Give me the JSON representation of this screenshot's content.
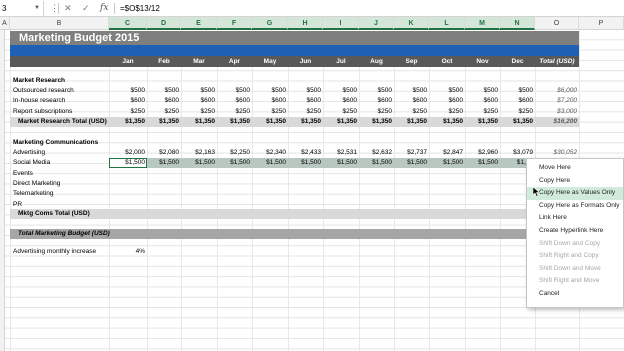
{
  "formula_bar": {
    "name_box": "3",
    "formula": "=$O$13/12",
    "cancel_symbol": "✕",
    "enter_symbol": "✓",
    "fx_symbol": "fx"
  },
  "columns": [
    "A",
    "B",
    "C",
    "D",
    "E",
    "F",
    "G",
    "H",
    "I",
    "J",
    "K",
    "L",
    "M",
    "N",
    "O",
    "P"
  ],
  "sheet": {
    "title": "Marketing Budget 2015",
    "months": [
      "Jan",
      "Feb",
      "Mar",
      "Apr",
      "May",
      "Jun",
      "Jul",
      "Aug",
      "Sep",
      "Oct",
      "Nov",
      "Dec"
    ],
    "total_header": "Total (USD)",
    "market_research": {
      "heading": "Market Research",
      "rows": [
        {
          "label": "Outsourced research",
          "values": [
            "$500",
            "$500",
            "$500",
            "$500",
            "$500",
            "$500",
            "$500",
            "$500",
            "$500",
            "$500",
            "$500",
            "$500"
          ],
          "total": "$6,000"
        },
        {
          "label": "In-house research",
          "values": [
            "$600",
            "$600",
            "$600",
            "$600",
            "$600",
            "$600",
            "$600",
            "$600",
            "$600",
            "$600",
            "$600",
            "$600"
          ],
          "total": "$7,200"
        },
        {
          "label": "Report subscriptions",
          "values": [
            "$250",
            "$250",
            "$250",
            "$250",
            "$250",
            "$250",
            "$250",
            "$250",
            "$250",
            "$250",
            "$250",
            "$250"
          ],
          "total": "$3,000"
        }
      ],
      "total_row": {
        "label": "Market Research Total (USD)",
        "values": [
          "$1,350",
          "$1,350",
          "$1,350",
          "$1,350",
          "$1,350",
          "$1,350",
          "$1,350",
          "$1,350",
          "$1,350",
          "$1,350",
          "$1,350",
          "$1,350"
        ],
        "total": "$16,200"
      }
    },
    "marketing_comms": {
      "heading": "Marketing Communications",
      "rows": [
        {
          "label": "Advertising",
          "values": [
            "$2,000",
            "$2,080",
            "$2,163",
            "$2,250",
            "$2,340",
            "$2,433",
            "$2,531",
            "$2,632",
            "$2,737",
            "$2,847",
            "$2,960",
            "$3,079"
          ],
          "total": "$30,052"
        },
        {
          "label": "Social Media",
          "values": [
            "$1,500",
            "$1,500",
            "$1,500",
            "$1,500",
            "$1,500",
            "$1,500",
            "$1,500",
            "$1,500",
            "$1,500",
            "$1,500",
            "$1,500",
            "$1,50"
          ],
          "total": ""
        },
        {
          "label": "Events",
          "values": [],
          "total": ""
        },
        {
          "label": "Direct Marketing",
          "values": [],
          "total": ""
        },
        {
          "label": "Telemarketing",
          "values": [],
          "total": ""
        },
        {
          "label": "PR",
          "values": [],
          "total": ""
        }
      ],
      "total_row": {
        "label": "Mktg Coms Total (USD)"
      }
    },
    "grand_total_label": "Total Marketing Budget (USD)",
    "increase_label": "Advertising monthly increase",
    "increase_value": "4%"
  },
  "context_menu": {
    "items": [
      {
        "label": "Move Here",
        "enabled": true
      },
      {
        "label": "Copy Here",
        "enabled": true
      },
      {
        "label": "Copy Here as Values Only",
        "enabled": true
      },
      {
        "label": "Copy Here as Formats Only",
        "enabled": true
      },
      {
        "label": "Link Here",
        "enabled": true
      },
      {
        "label": "Create Hyperlink Here",
        "enabled": true
      },
      {
        "label": "Shift Down and Copy",
        "enabled": false
      },
      {
        "label": "Shift Right and Copy",
        "enabled": false
      },
      {
        "label": "Shift Down and Move",
        "enabled": false
      },
      {
        "label": "Shift Right and Move",
        "enabled": false
      },
      {
        "label": "Cancel",
        "enabled": true
      }
    ],
    "hovered_index": 2
  },
  "colors": {
    "accent_green": "#217346",
    "title_gray": "#7f7f7f",
    "header_blue": "#1f5fb4",
    "header_dark": "#595959",
    "menu_hover": "#d1ebdb"
  }
}
